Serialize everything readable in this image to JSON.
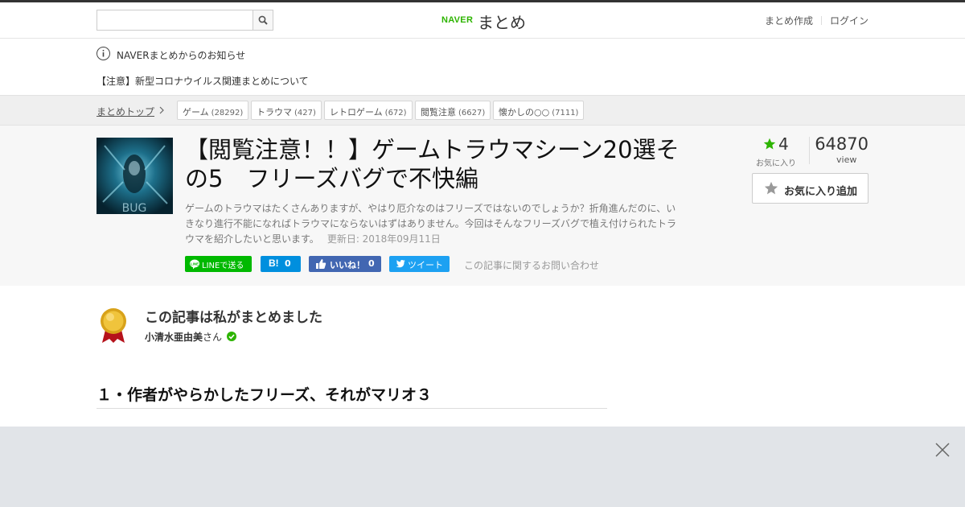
{
  "header": {
    "logo_naver": "NAVER",
    "logo_matome": "まとめ",
    "search": {
      "placeholder": "",
      "value": ""
    },
    "links": {
      "create": "まとめ作成",
      "login": "ログイン"
    }
  },
  "notices": {
    "info": "NAVERまとめからのお知らせ",
    "covid": "【注意】新型コロナウイルス関連まとめについて"
  },
  "breadcrumb": {
    "home": "まとめトップ",
    "tags": [
      {
        "label": "ゲーム",
        "count": "(28292)"
      },
      {
        "label": "トラウマ",
        "count": "(427)"
      },
      {
        "label": "レトロゲーム",
        "count": "(672)"
      },
      {
        "label": "閲覧注意",
        "count": "(6627)"
      },
      {
        "label": "懐かしの○○",
        "count": "(7111)"
      }
    ]
  },
  "article": {
    "title": "【閲覧注意！！】ゲームトラウマシーン20選その5　フリーズバグで不快編",
    "description": "ゲームのトラウマはたくさんありますが、やはり厄介なのはフリーズではないのでしょうか？折角進んだのに、いきなり進行不能になればトラウマにならないはずはありません。今回はそんなフリーズバグで植え付けられたトラウマを紹介したいと思います。",
    "updated": "更新日: 2018年09月11日",
    "thumbnail_text": "BUG",
    "share": {
      "line": "LINEで送る",
      "hatena_count": "0",
      "fb_label": "いいね！",
      "fb_count": "0",
      "tweet": "ツイート"
    },
    "contact": "この記事に関するお問い合わせ",
    "favorites": "4",
    "favorites_label": "お気に入り",
    "views": "64870",
    "views_label": "view",
    "fav_button": "お気に入り追加"
  },
  "author": {
    "heading": "この記事は私がまとめました",
    "name": "小清水亜由美",
    "suffix": "さん"
  },
  "section": {
    "heading": "１・作者がやらかしたフリーズ、それがマリオ３"
  },
  "colors": {
    "brand_green": "#2db400",
    "line": "#00b900",
    "hatena": "#008fde",
    "facebook": "#4267b2",
    "twitter": "#1da1f2",
    "overlay": "#e1e4e8"
  }
}
